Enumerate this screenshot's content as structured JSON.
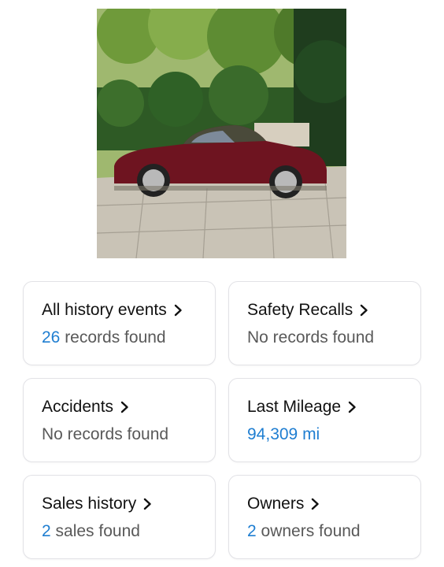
{
  "photo": {
    "alt_icon": "car-photo"
  },
  "cards": [
    {
      "title": "All history events",
      "count": "26",
      "sub": " records found"
    },
    {
      "title": "Safety Recalls",
      "count": "",
      "sub": "No records found"
    },
    {
      "title": "Accidents",
      "count": "",
      "sub": "No records found"
    },
    {
      "title": "Last Mileage",
      "count": "94,309 mi",
      "sub": ""
    },
    {
      "title": "Sales history",
      "count": "2",
      "sub": " sales found"
    },
    {
      "title": "Owners",
      "count": "2",
      "sub": " owners found"
    }
  ],
  "colors": {
    "link_blue": "#1f7ed1",
    "muted_text": "#595959",
    "card_border": "#e2e2e6"
  }
}
